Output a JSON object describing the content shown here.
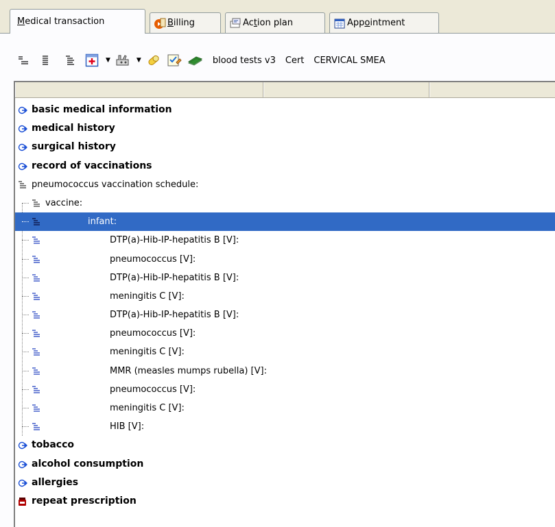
{
  "tabs": [
    {
      "label": "Medical transaction",
      "accel": "M",
      "rest": "edical transaction"
    },
    {
      "label": "Billing",
      "accel": "B",
      "rest": "illing"
    },
    {
      "label": "Action plan",
      "pre": "Ac",
      "accel": "t",
      "rest": "ion plan"
    },
    {
      "label": "Appointment",
      "pre": "App",
      "accel": "o",
      "rest": "intment"
    }
  ],
  "toolbar": {
    "buttons": [
      {
        "icon": "collapse-lines-icon"
      },
      {
        "icon": "column-lines-icon"
      },
      {
        "icon": "expand-lines-icon"
      },
      {
        "icon": "add-item-icon"
      },
      {
        "icon": "tools-icon"
      },
      {
        "icon": "pill-icon"
      },
      {
        "icon": "checklist-icon"
      },
      {
        "icon": "money-icon"
      }
    ],
    "shortcuts": [
      "blood tests v3",
      "Cert",
      "CERVICAL SMEA"
    ]
  },
  "tree": {
    "groups_top": [
      {
        "label": "basic medical information",
        "icon": "expand-arrow-icon"
      },
      {
        "label": "medical history",
        "icon": "expand-arrow-icon"
      },
      {
        "label": "surgical history",
        "icon": "expand-arrow-icon"
      },
      {
        "label": "record of vaccinations",
        "icon": "expand-arrow-icon"
      }
    ],
    "schedule_label": "pneumococcus vaccination schedule:",
    "vaccine_label": "vaccine:",
    "infant_label": "infant:",
    "items": [
      "DTP(a)-Hib-IP-hepatitis B [V]:",
      "pneumococcus [V]:",
      "DTP(a)-Hib-IP-hepatitis B [V]:",
      "meningitis C [V]:",
      "DTP(a)-Hib-IP-hepatitis B [V]:",
      "pneumococcus [V]:",
      "meningitis C [V]:",
      "MMR (measles mumps rubella) [V]:",
      "pneumococcus [V]:",
      "meningitis C [V]:",
      "HIB [V]:"
    ],
    "groups_bottom": [
      {
        "label": "tobacco",
        "icon": "expand-arrow-icon"
      },
      {
        "label": "alcohol consumption",
        "icon": "expand-arrow-icon"
      },
      {
        "label": "allergies",
        "icon": "expand-arrow-icon"
      },
      {
        "label": "repeat prescription",
        "icon": "prescription-icon"
      }
    ]
  },
  "colors": {
    "selection": "#316ac5",
    "arrow": "#1a4fd6"
  }
}
